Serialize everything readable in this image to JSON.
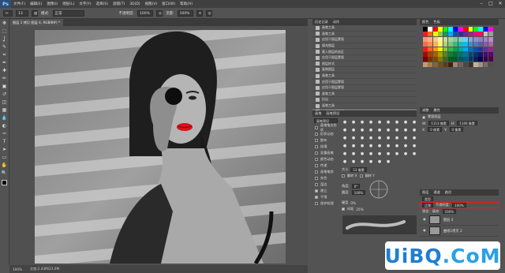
{
  "app": {
    "logo": "Ps"
  },
  "menu": [
    "文件(F)",
    "编辑(E)",
    "图像(I)",
    "图层(L)",
    "文字(Y)",
    "选择(S)",
    "滤镜(T)",
    "3D(D)",
    "视图(V)",
    "窗口(W)",
    "帮助(H)"
  ],
  "window_controls": [
    "–",
    "□",
    "✕"
  ],
  "options": {
    "size": "13",
    "mode_label": "模式:",
    "mode_value": "正常",
    "opacity_label": "不透明度:",
    "opacity_value": "100%",
    "flow_label": "流量:",
    "flow_value": "100%"
  },
  "tools": [
    "move-icon",
    "marquee-icon",
    "lasso-icon",
    "quickselect-icon",
    "crop-icon",
    "eyedropper-icon",
    "heal-icon",
    "brush-icon",
    "stamp-icon",
    "history-brush-icon",
    "eraser-icon",
    "gradient-icon",
    "blur-icon",
    "dodge-icon",
    "pen-icon",
    "type-icon",
    "path-select-icon",
    "shape-icon",
    "hand-icon",
    "zoom-icon"
  ],
  "tool_glyphs": [
    "✥",
    "⬚",
    "ʆ",
    "✎",
    "⌗",
    "✒",
    "✚",
    "✏",
    "▣",
    "↺",
    "◫",
    "▦",
    "💧",
    "◐",
    "✑",
    "T",
    "➤",
    "▭",
    "✋",
    "🔍"
  ],
  "document": {
    "tab": "图层 1 拷贝 图层 4, RGB/8#) *",
    "zoom": "100%",
    "doc_info": "文档:2.43M/23.0M"
  },
  "history": {
    "header": [
      "历史记录",
      "动作"
    ],
    "items": [
      "画笔工具",
      "画笔工具",
      "应用于图层蒙版",
      "填充图层",
      "载入图层的选区",
      "应用于图层蒙版",
      "图层样式",
      "复制图层",
      "画笔工具",
      "应用于图层蒙版",
      "应用于图层蒙版",
      "画笔工具",
      "拉出",
      "画笔工具",
      "应用于图层蒙版"
    ],
    "selected_index": 14
  },
  "swatches": {
    "header": [
      "颜色",
      "色板"
    ],
    "colors": [
      "#000000",
      "#ffffff",
      "#ff0000",
      "#ffff00",
      "#00ff00",
      "#00ffff",
      "#0000ff",
      "#ff00ff",
      "#ff0000",
      "#ffff00",
      "#00ff00",
      "#00ffff",
      "#0000ff",
      "#ff00ff",
      "#ed1c24",
      "#f26522",
      "#fff200",
      "#8dc63f",
      "#00a651",
      "#00aeef",
      "#0054a6",
      "#2e3192",
      "#662d91",
      "#92278f",
      "#ec008c",
      "#ed145b",
      "#c4c4c4",
      "#9a9a9a",
      "#f7977a",
      "#fbad82",
      "#fdc68c",
      "#fff79a",
      "#c4df9b",
      "#a3d39c",
      "#82ca9d",
      "#7bcdc8",
      "#6ecff6",
      "#7ea7d8",
      "#8493ca",
      "#8882be",
      "#a187be",
      "#bc8dbf",
      "#f26c4f",
      "#f68e55",
      "#fbaf5c",
      "#fff467",
      "#acd372",
      "#7cc576",
      "#3bb878",
      "#1abbb4",
      "#00bff3",
      "#438ccb",
      "#5574b9",
      "#605ca8",
      "#855fa8",
      "#a763a8",
      "#ed1c24",
      "#f26522",
      "#f7941d",
      "#fff200",
      "#8dc63f",
      "#39b54a",
      "#00a651",
      "#00a99d",
      "#00aeef",
      "#0072bc",
      "#0054a6",
      "#2e3192",
      "#662d91",
      "#92278f",
      "#9e0b0f",
      "#a0410d",
      "#a36209",
      "#aba000",
      "#598527",
      "#1a7b30",
      "#007236",
      "#00746b",
      "#0076a3",
      "#004a80",
      "#003471",
      "#1b1464",
      "#440e62",
      "#630460",
      "#790000",
      "#7b2e00",
      "#7d4900",
      "#827b00",
      "#406618",
      "#005e20",
      "#005826",
      "#005952",
      "#005b7f",
      "#003663",
      "#002157",
      "#0d004c",
      "#32004b",
      "#4b0049",
      "#c69c6d",
      "#a67c52",
      "#8c6239",
      "#754c24",
      "#603913",
      "#42210b",
      "#998675",
      "#736357",
      "#534741",
      "#362f2d",
      "#c7b299",
      "#a0948a",
      "#7a6e65",
      "#564d47"
    ]
  },
  "adjust": {
    "header": [
      "调整",
      "属性"
    ],
    "label": "蒙版图层",
    "w_label": "W:",
    "w_value": "1113 像素",
    "h_label": "H:",
    "h_value": "1146 像素",
    "x_label": "X:",
    "x_value": "0 像素",
    "y_label": "Y:",
    "y_value": "0 像素"
  },
  "brush": {
    "header": [
      "画笔",
      "画笔预设"
    ],
    "preset_button": "画笔预设",
    "options": [
      "画笔笔尖形状",
      "形状动态",
      "散布",
      "纹理",
      "双重画笔",
      "颜色动态",
      "传递",
      "画笔笔势",
      "杂色",
      "湿边",
      "建立",
      "平滑",
      "保护纹理"
    ],
    "checked": [
      false,
      false,
      false,
      false,
      false,
      false,
      false,
      false,
      false,
      false,
      true,
      true,
      false
    ],
    "tips": [
      "30",
      "30",
      "30",
      "25",
      "25",
      "25",
      "36",
      "25",
      "36",
      "36",
      "36",
      "32",
      "25",
      "14",
      "24",
      "27",
      "39",
      "46",
      "59",
      "11",
      "17",
      "23",
      "36",
      "44",
      "60",
      "14",
      "26",
      "33",
      "42",
      "55",
      "70",
      "112",
      "134",
      "74",
      "95",
      "95",
      "90",
      "36",
      "36",
      "33",
      "63",
      "66",
      "39",
      "63",
      "11",
      "48",
      "32",
      "55",
      "100",
      "75",
      "45"
    ],
    "size_label": "大小",
    "size_value": "13 像素",
    "flipx": "翻转 X",
    "flipy": "翻转 Y",
    "angle_label": "角度:",
    "angle_value": "0°",
    "round_label": "圆度:",
    "round_value": "100%",
    "hard_label": "硬度",
    "hard_value": "0%",
    "spacing_label": "间距",
    "spacing_value": "25%"
  },
  "layers": {
    "header": [
      "图层",
      "通道",
      "路径"
    ],
    "kind": "类型",
    "blend": "正常",
    "opacity_label": "不透明度:",
    "opacity_value": "100%",
    "lock_label": "锁定:",
    "fill_label": "填充:",
    "fill_value": "100%",
    "rows": [
      {
        "name": "图层 4"
      },
      {
        "name": "曲线1拷贝 2"
      }
    ],
    "fx_label": "fx"
  },
  "watermark": {
    "part1": "UiBQ",
    "part2": ".CoM",
    "color1": "#1f7fd0",
    "color2": "#2aa0e6"
  }
}
